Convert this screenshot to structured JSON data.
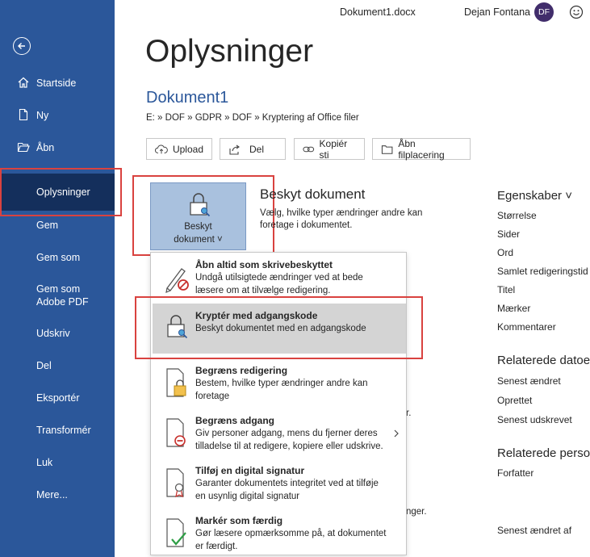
{
  "topbar": {
    "filename": "Dokument1.docx",
    "user": "Dejan Fontana",
    "initials": "DF"
  },
  "sidebar": {
    "items": [
      {
        "label": "Startside"
      },
      {
        "label": "Ny"
      },
      {
        "label": "Åbn"
      },
      {
        "label": "Oplysninger"
      },
      {
        "label": "Gem"
      },
      {
        "label": "Gem som"
      },
      {
        "label": "Gem som\nAdobe PDF"
      },
      {
        "label": "Udskriv"
      },
      {
        "label": "Del"
      },
      {
        "label": "Eksportér"
      },
      {
        "label": "Transformér"
      },
      {
        "label": "Luk"
      },
      {
        "label": "Mere..."
      }
    ]
  },
  "main": {
    "heading": "Oplysninger",
    "doc_title": "Dokument1",
    "path": "E: » DOF » GDPR » DOF » Kryptering af Office filer",
    "buttons": [
      "Upload",
      "Del",
      "Kopiér sti",
      "Åbn filplacering"
    ],
    "protect": {
      "tile_label_1": "Beskyt",
      "tile_label_2": "dokument ˅",
      "heading": "Beskyt dokument",
      "desc": "Vælg, hvilke typer ændringer andre kan foretage i dokumentet."
    },
    "hidden_fragments": [
      "r.",
      "nger."
    ]
  },
  "menu": {
    "items": [
      {
        "title": "Åbn altid som skrivebeskyttet",
        "desc": "Undgå utilsigtede ændringer ved at bede læsere om at tilvælge redigering."
      },
      {
        "title": "Kryptér med adgangskode",
        "desc": "Beskyt dokumentet med en adgangskode"
      },
      {
        "title": "Begræns redigering",
        "desc": "Bestem, hvilke typer ændringer andre kan foretage"
      },
      {
        "title": "Begræns adgang",
        "desc": "Giv personer adgang, mens du fjerner deres tilladelse til at redigere, kopiere eller udskrive."
      },
      {
        "title": "Tilføj en digital signatur",
        "desc": "Garanter dokumentets integritet ved at tilføje en usynlig digital signatur"
      },
      {
        "title": "Markér som færdig",
        "desc": "Gør læsere opmærksomme på, at dokumentet er færdigt."
      }
    ]
  },
  "properties": {
    "heading": "Egenskaber ˅",
    "items": [
      "Størrelse",
      "Sider",
      "Ord",
      "Samlet redigeringstid",
      "Titel",
      "Mærker",
      "Kommentarer"
    ],
    "related_dates_heading": "Relaterede datoer",
    "dates": [
      "Senest ændret",
      "Oprettet",
      "Senest udskrevet"
    ],
    "related_people_heading": "Relaterede personer",
    "people": [
      "Forfatter"
    ],
    "last_modified_by": "Senest ændret af"
  },
  "colors": {
    "sidebar": "#2b579a",
    "active": "#142f5c",
    "highlight": "#d4d4d4",
    "annotation": "#d9423f"
  }
}
